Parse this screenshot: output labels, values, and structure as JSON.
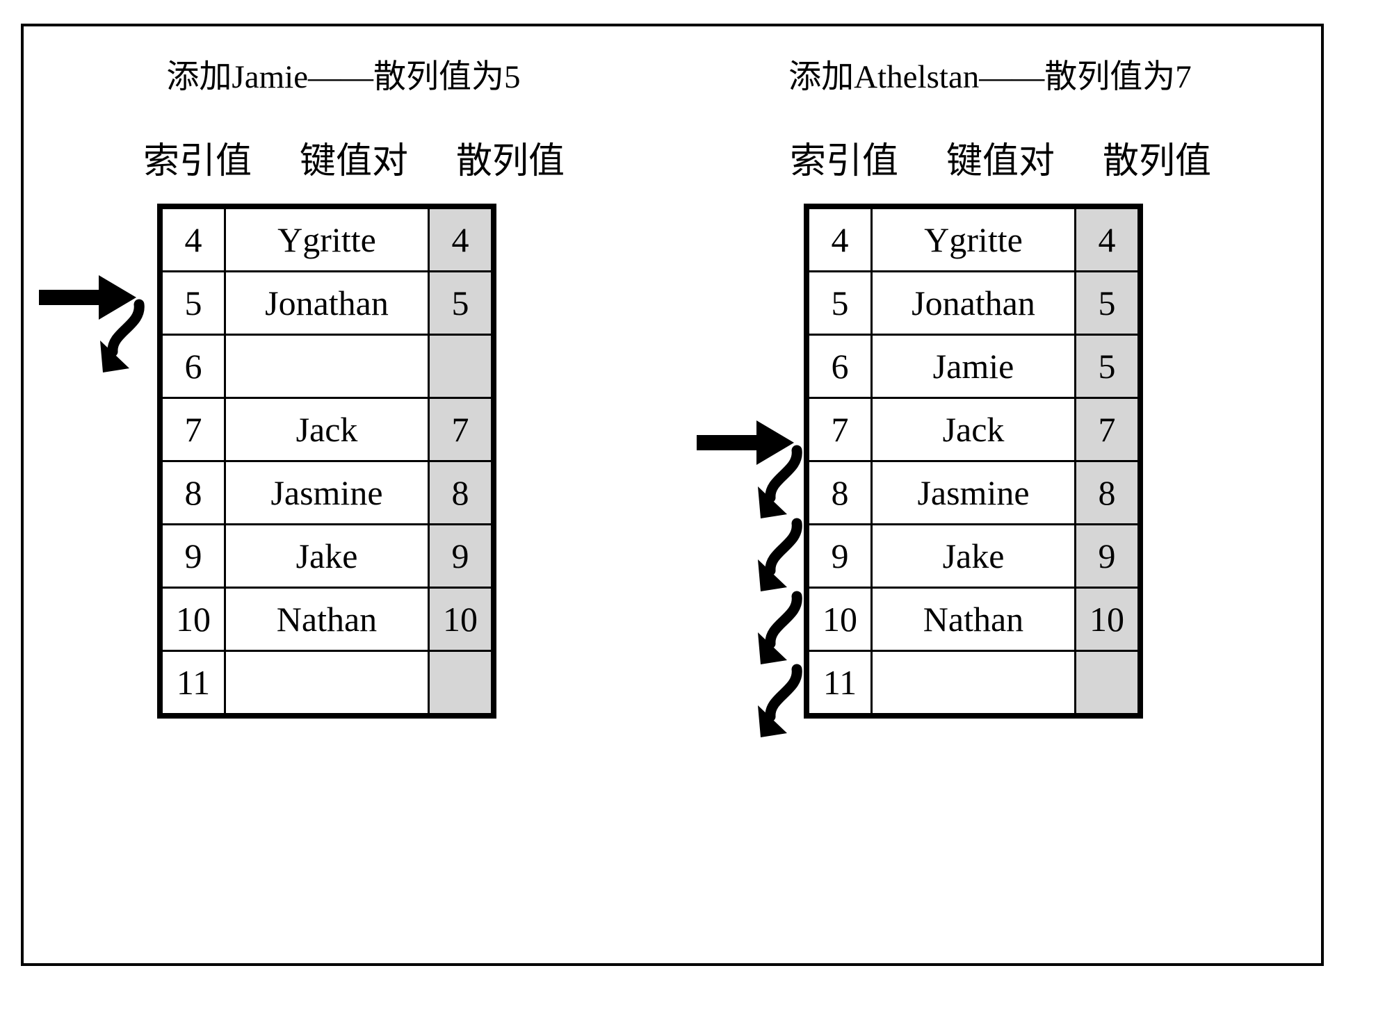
{
  "diagram": {
    "caption_left": "添加Jamie——散列值为5",
    "caption_right": "添加Athelstan——散列值为7",
    "headers": {
      "index": "索引值",
      "keyvalue": "键值对",
      "hash": "散列值"
    },
    "colors": {
      "hash_column_fill": "#d6d6d6",
      "border": "#000000",
      "background": "#ffffff"
    }
  },
  "left_panel": {
    "title": "添加Jamie——散列值为5",
    "rows": [
      {
        "index": "4",
        "key": "Ygritte",
        "hash": "4"
      },
      {
        "index": "5",
        "key": "Jonathan",
        "hash": "5"
      },
      {
        "index": "6",
        "key": "",
        "hash": ""
      },
      {
        "index": "7",
        "key": "Jack",
        "hash": "7"
      },
      {
        "index": "8",
        "key": "Jasmine",
        "hash": "8"
      },
      {
        "index": "9",
        "key": "Jake",
        "hash": "9"
      },
      {
        "index": "10",
        "key": "Nathan",
        "hash": "10"
      },
      {
        "index": "11",
        "key": "",
        "hash": ""
      }
    ],
    "entry_arrow_target_index": "5",
    "probe_arrows": [
      {
        "from_index": "5",
        "to_index": "6"
      }
    ]
  },
  "right_panel": {
    "title": "添加Athelstan——散列值为7",
    "rows": [
      {
        "index": "4",
        "key": "Ygritte",
        "hash": "4"
      },
      {
        "index": "5",
        "key": "Jonathan",
        "hash": "5"
      },
      {
        "index": "6",
        "key": "Jamie",
        "hash": "5"
      },
      {
        "index": "7",
        "key": "Jack",
        "hash": "7"
      },
      {
        "index": "8",
        "key": "Jasmine",
        "hash": "8"
      },
      {
        "index": "9",
        "key": "Jake",
        "hash": "9"
      },
      {
        "index": "10",
        "key": "Nathan",
        "hash": "10"
      },
      {
        "index": "11",
        "key": "",
        "hash": ""
      }
    ],
    "entry_arrow_target_index": "7",
    "probe_arrows": [
      {
        "from_index": "7",
        "to_index": "8"
      },
      {
        "from_index": "8",
        "to_index": "9"
      },
      {
        "from_index": "9",
        "to_index": "10"
      },
      {
        "from_index": "10",
        "to_index": "11"
      }
    ]
  }
}
